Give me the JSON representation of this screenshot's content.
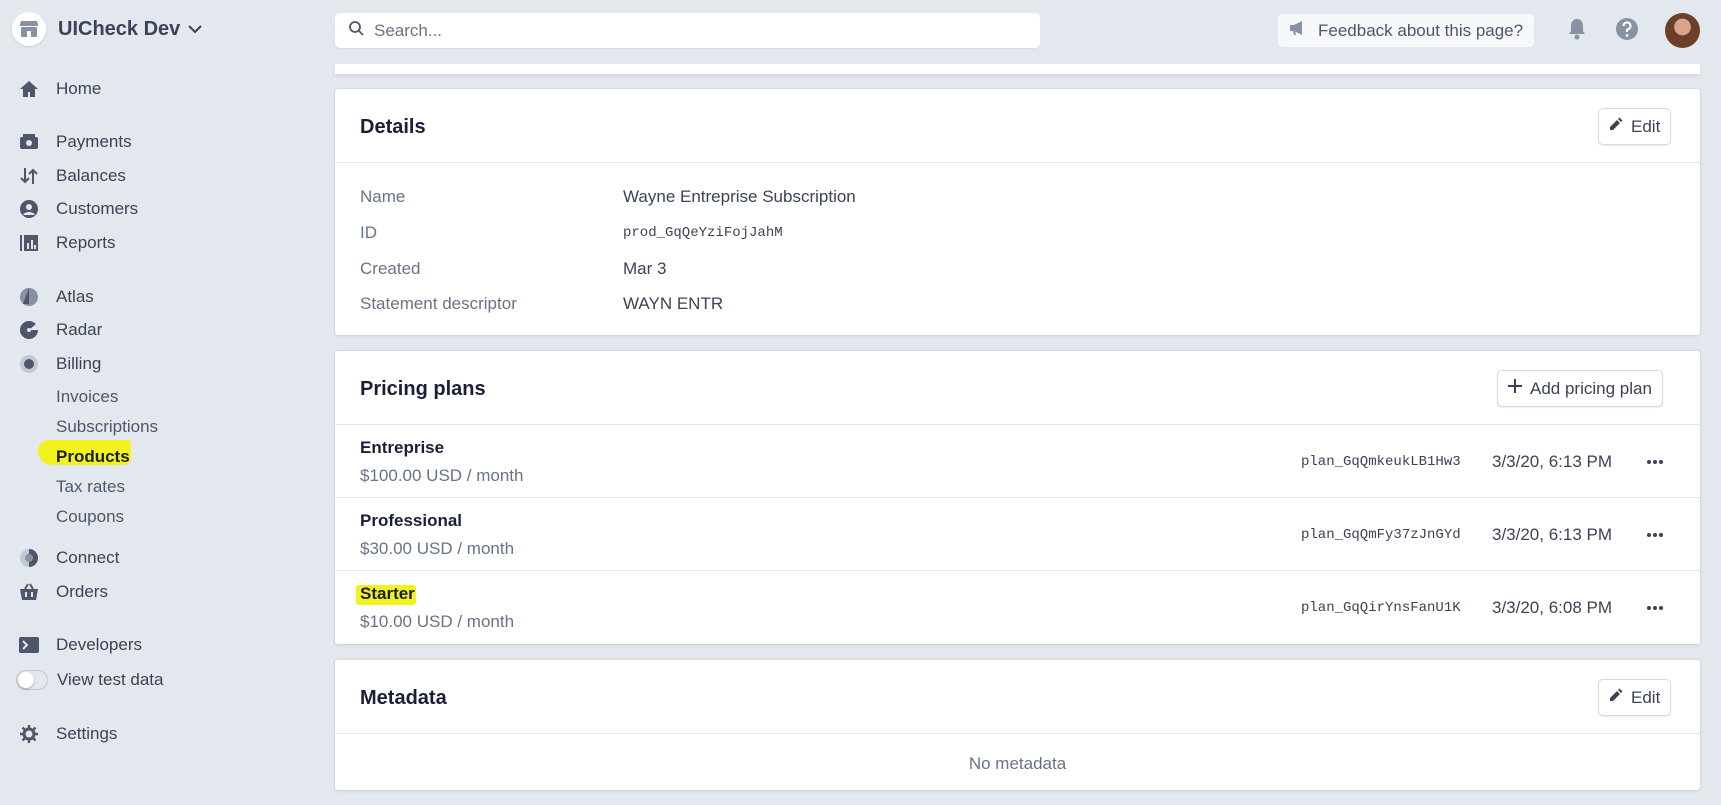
{
  "account": {
    "name": "UICheck Dev"
  },
  "sidebar": {
    "items": [
      {
        "label": "Home",
        "icon": "home-icon"
      },
      {
        "label": "Payments",
        "icon": "payments-icon"
      },
      {
        "label": "Balances",
        "icon": "balances-icon"
      },
      {
        "label": "Customers",
        "icon": "customers-icon"
      },
      {
        "label": "Reports",
        "icon": "reports-icon"
      },
      {
        "label": "Atlas",
        "icon": "atlas-icon"
      },
      {
        "label": "Radar",
        "icon": "radar-icon"
      },
      {
        "label": "Billing",
        "icon": "billing-icon"
      }
    ],
    "billing_subitems": [
      "Invoices",
      "Subscriptions",
      "Products",
      "Tax rates",
      "Coupons"
    ],
    "active_subitem": "Products",
    "lower_items": [
      {
        "label": "Connect",
        "icon": "connect-icon"
      },
      {
        "label": "Orders",
        "icon": "orders-icon"
      },
      {
        "label": "Developers",
        "icon": "developers-icon"
      }
    ],
    "test_data_label": "View test data",
    "test_data_on": false,
    "settings_label": "Settings"
  },
  "topbar": {
    "search_placeholder": "Search...",
    "feedback_label": "Feedback about this page?"
  },
  "details": {
    "title": "Details",
    "edit_label": "Edit",
    "rows": [
      {
        "label": "Name",
        "value": "Wayne Entreprise Subscription"
      },
      {
        "label": "ID",
        "value": "prod_GqQeYziFojJahM"
      },
      {
        "label": "Created",
        "value": "Mar 3"
      },
      {
        "label": "Statement descriptor",
        "value": "WAYN ENTR"
      }
    ]
  },
  "pricing": {
    "title": "Pricing plans",
    "add_label": "Add pricing plan",
    "plans": [
      {
        "name": "Entreprise",
        "price": "$100.00 USD / month",
        "id": "plan_GqQmkeukLB1Hw3",
        "created": "3/3/20, 6:13 PM"
      },
      {
        "name": "Professional",
        "price": "$30.00 USD / month",
        "id": "plan_GqQmFy37zJnGYd",
        "created": "3/3/20, 6:13 PM"
      },
      {
        "name": "Starter",
        "price": "$10.00 USD / month",
        "id": "plan_GqQirYnsFanU1K",
        "created": "3/3/20, 6:08 PM"
      }
    ]
  },
  "metadata": {
    "title": "Metadata",
    "edit_label": "Edit",
    "empty_text": "No metadata"
  },
  "colors": {
    "background": "#e3e8ee",
    "highlight": "#f2f21c",
    "icon": "#4f566b"
  }
}
